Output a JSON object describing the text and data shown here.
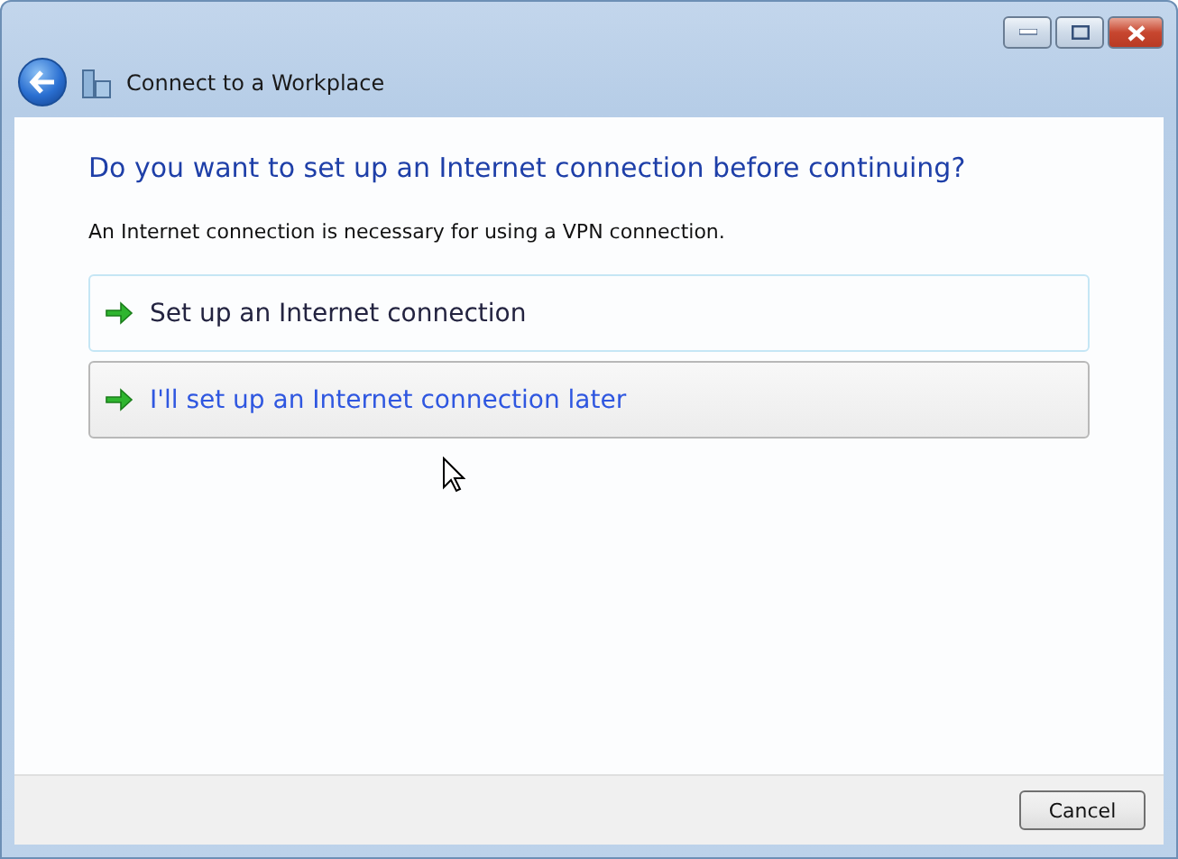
{
  "window": {
    "title": "Connect to a Workplace"
  },
  "heading": "Do you want to set up an Internet connection before continuing?",
  "description": "An Internet connection is necessary for using a VPN connection.",
  "options": [
    {
      "label": "Set up an Internet connection",
      "focused": true,
      "hovered": false
    },
    {
      "label": "I'll set up an Internet connection later",
      "focused": false,
      "hovered": true
    }
  ],
  "buttons": [
    "Cancel"
  ]
}
